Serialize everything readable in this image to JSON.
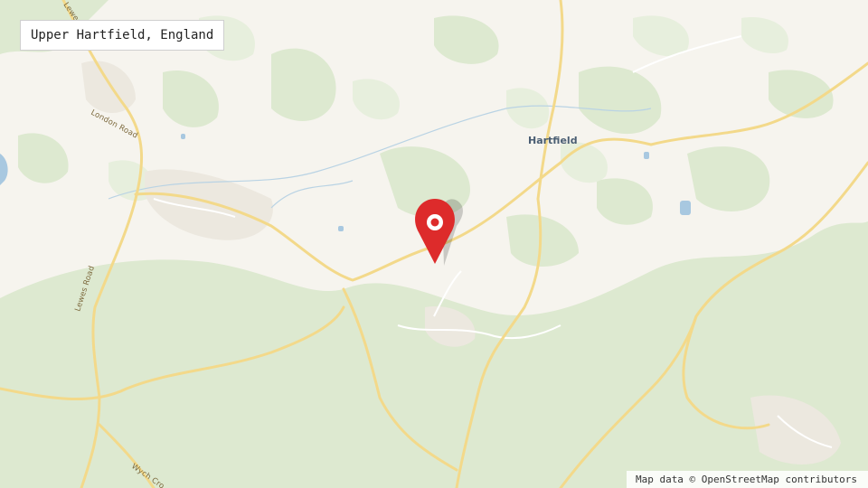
{
  "location": {
    "label": "Upper Hartfield, England"
  },
  "map": {
    "place_labels": {
      "hartfield": "Hartfield"
    },
    "road_labels": {
      "london_road": "London Road",
      "lewes_road": "Lewes Road",
      "wych_cross": "Wych Cro",
      "lewes_top": "Lewes R"
    },
    "marker_icon": "map-pin",
    "colors": {
      "land": "#f6f4ee",
      "woodland": "#dbe9cf",
      "woodland_light": "#e6efdc",
      "road_major": "#f6dc8f",
      "road_minor": "#ffffff",
      "water": "#a8c8e0",
      "marker": "#dd2b2b"
    }
  },
  "attribution": {
    "text": "Map data © OpenStreetMap contributors"
  }
}
